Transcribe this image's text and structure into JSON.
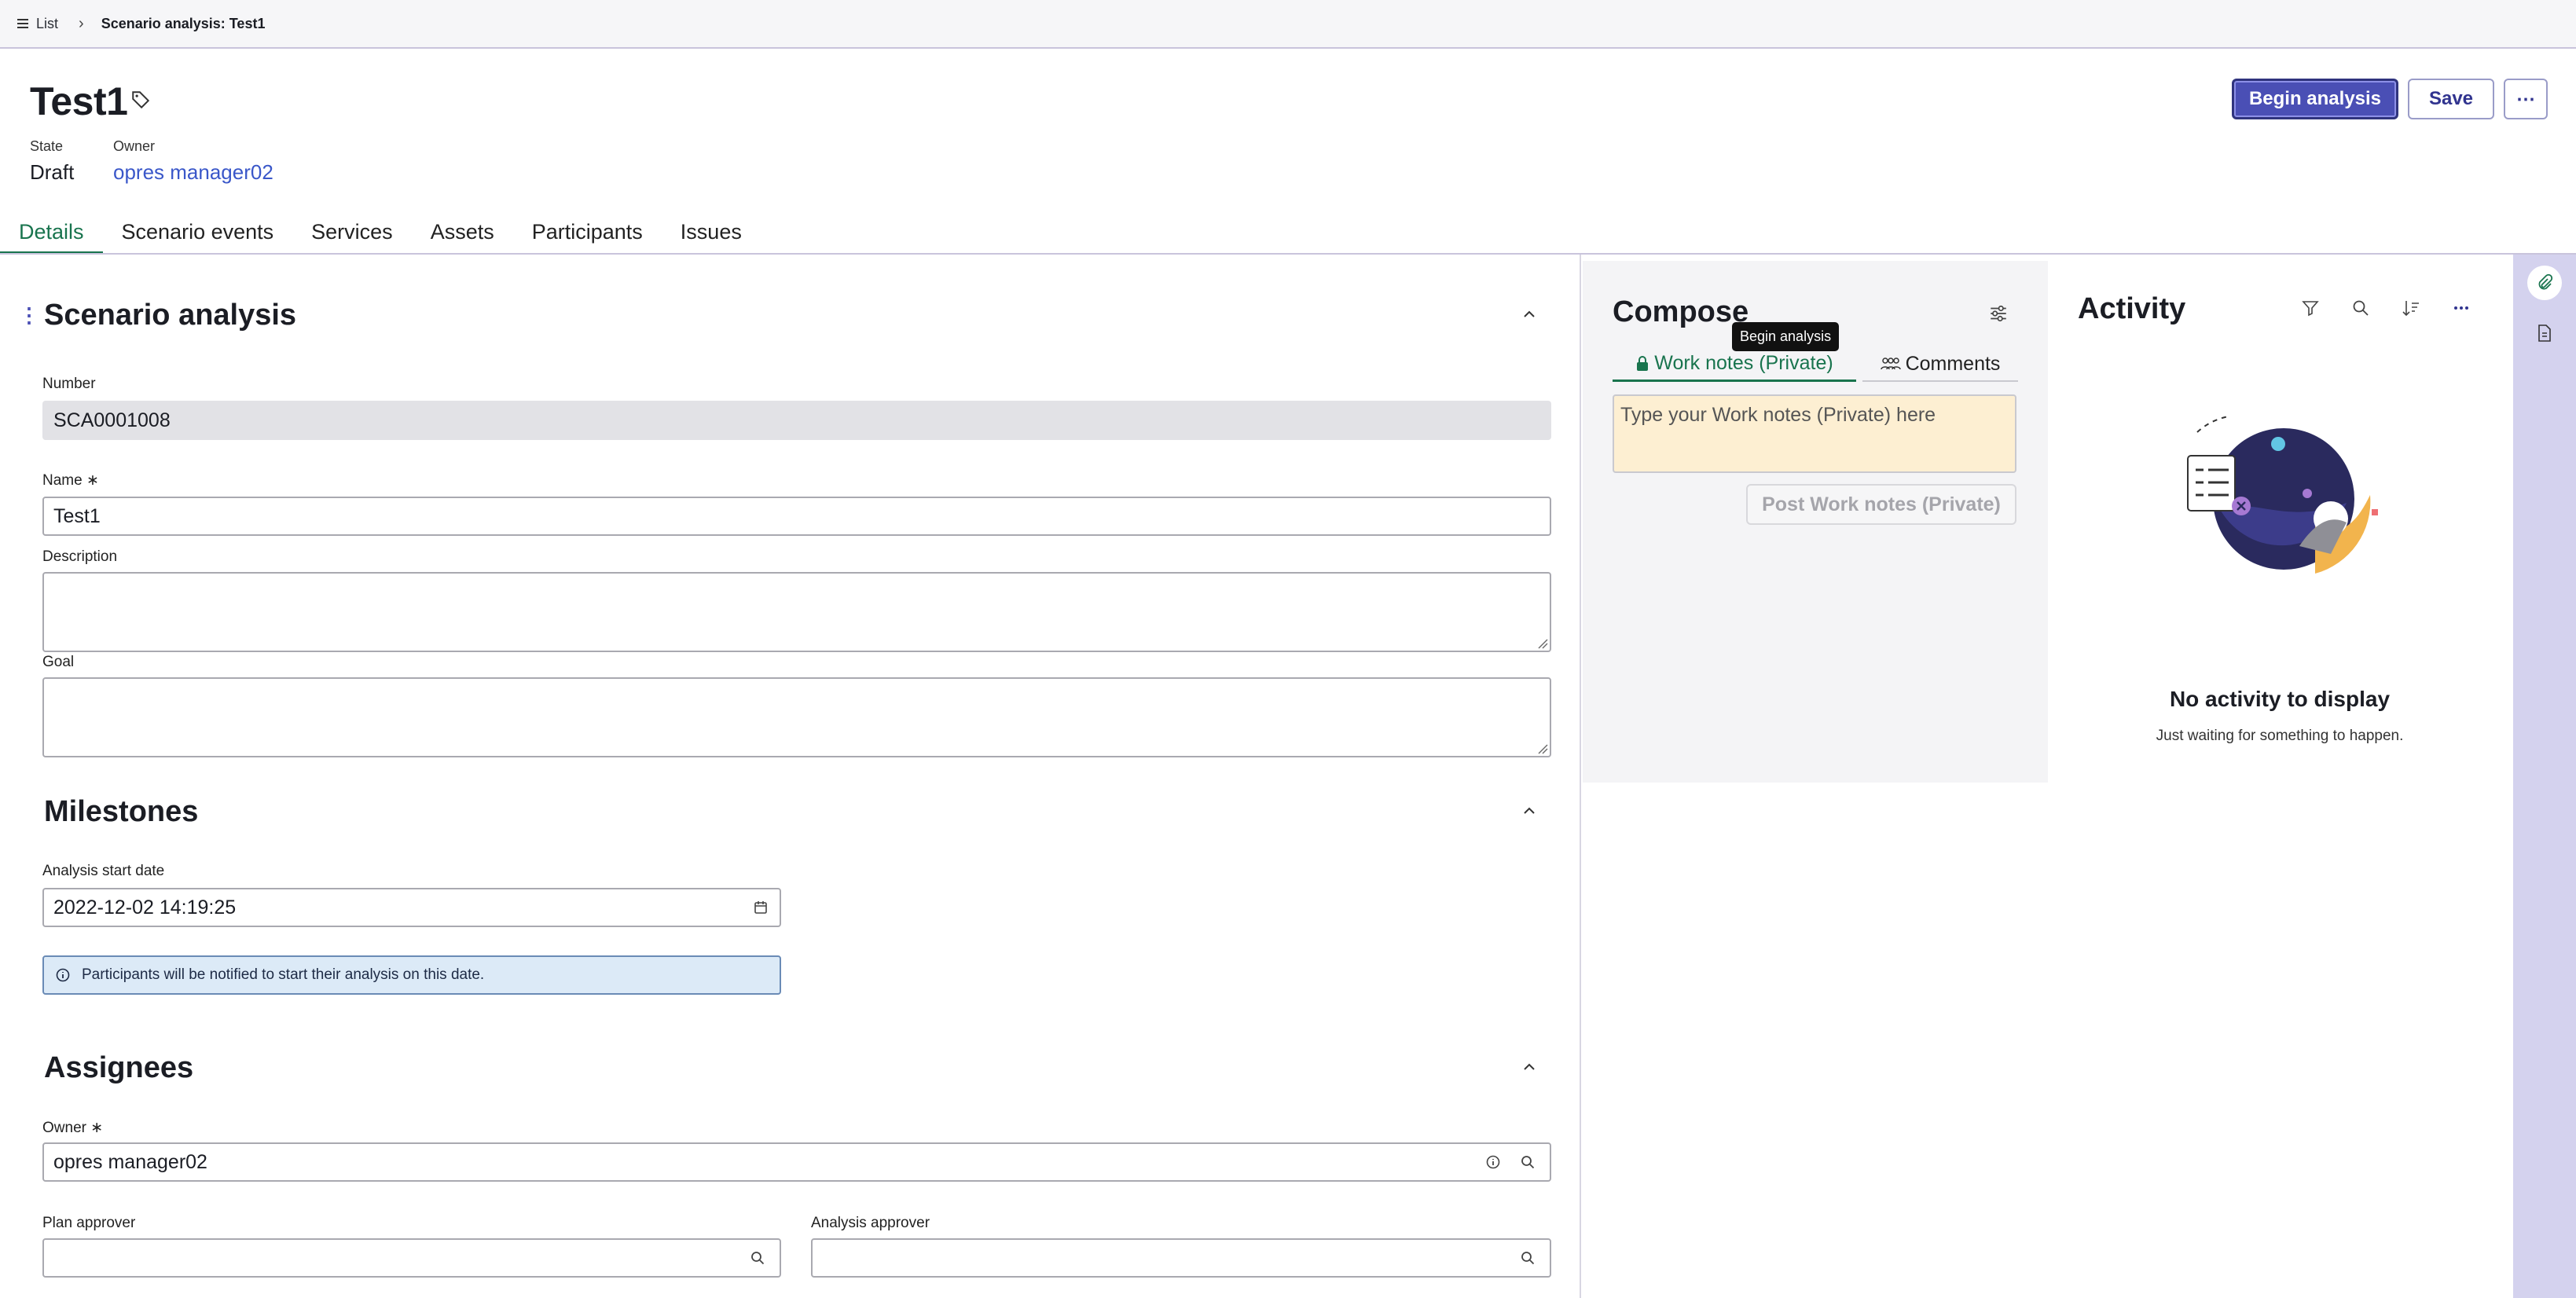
{
  "breadcrumb": {
    "list_label": "List",
    "current": "Scenario analysis: Test1"
  },
  "record": {
    "title": "Test1",
    "state_label": "State",
    "state_value": "Draft",
    "owner_label": "Owner",
    "owner_value": "opres manager02"
  },
  "actions": {
    "primary": "Begin analysis",
    "save": "Save",
    "more": "⋯"
  },
  "tabs": [
    {
      "label": "Details",
      "active": true
    },
    {
      "label": "Scenario events"
    },
    {
      "label": "Services"
    },
    {
      "label": "Assets"
    },
    {
      "label": "Participants"
    },
    {
      "label": "Issues"
    }
  ],
  "form": {
    "section1": "Scenario analysis",
    "number_label": "Number",
    "number_value": "SCA0001008",
    "name_label": "Name",
    "name_value": "Test1",
    "description_label": "Description",
    "goal_label": "Goal",
    "section2": "Milestones",
    "start_label": "Analysis start date",
    "start_value": "2022-12-02 14:19:25",
    "info_text": "Participants will be notified to start their analysis on this date.",
    "section3": "Assignees",
    "owner_label": "Owner",
    "owner_value": "opres manager02",
    "plan_approver_label": "Plan approver",
    "analysis_approver_label": "Analysis approver",
    "required_mark": "∗"
  },
  "compose": {
    "title": "Compose",
    "tooltip": "Begin analysis",
    "tab_work_notes": "Work notes (Private)",
    "tab_comments": "Comments",
    "placeholder": "Type your Work notes (Private) here",
    "post_button": "Post Work notes (Private)"
  },
  "activity": {
    "title": "Activity",
    "empty_title": "No activity to display",
    "empty_sub": "Just waiting for something to happen."
  },
  "colors": {
    "primary": "#4a4fb5",
    "active_tab": "#19744e",
    "link": "#3a57c9",
    "rail": "#d4d2ee",
    "compose_input": "#fdefd2"
  },
  "icons": [
    "list-icon",
    "chevron-right-icon",
    "tag-icon",
    "chevron-up-icon",
    "calendar-icon",
    "info-icon",
    "search-icon",
    "lock-icon",
    "people-icon",
    "settings-sliders-icon",
    "filter-icon",
    "sort-icon",
    "more-icon",
    "paperclip-icon",
    "document-icon"
  ]
}
